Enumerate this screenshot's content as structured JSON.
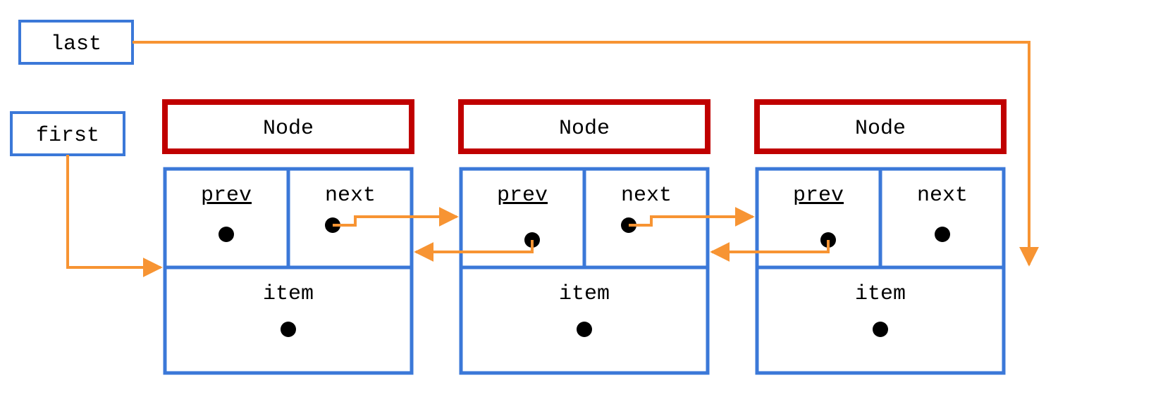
{
  "diagram": {
    "last_label": "last",
    "first_label": "first",
    "node_title": "Node",
    "prev_label": "prev",
    "next_label": "next",
    "item_label": "item",
    "colors": {
      "blue": "#3b78d8",
      "red": "#c00000",
      "orange": "#f79433",
      "black": "#000000"
    },
    "nodes_count": 3,
    "structure": "doubly-linked-list",
    "arrows": [
      {
        "from": "last",
        "to": "node3"
      },
      {
        "from": "first",
        "to": "node1"
      },
      {
        "from": "node1.next",
        "to": "node2"
      },
      {
        "from": "node2.next",
        "to": "node3"
      },
      {
        "from": "node2.prev",
        "to": "node1"
      },
      {
        "from": "node3.prev",
        "to": "node2"
      }
    ]
  }
}
